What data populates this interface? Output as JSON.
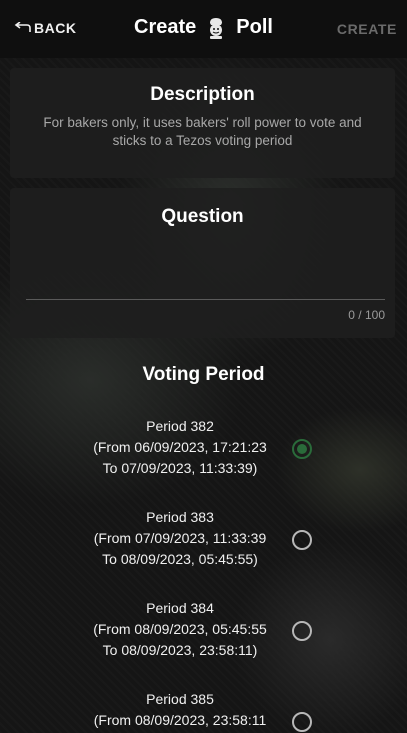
{
  "header": {
    "back_label": "BACK",
    "title_left": "Create",
    "title_right": "Poll",
    "create_label": "CREATE"
  },
  "description": {
    "heading": "Description",
    "text": "For bakers only, it uses bakers' roll power to vote and sticks to a Tezos voting period"
  },
  "question": {
    "heading": "Question",
    "value": "",
    "counter": "0 / 100"
  },
  "voting_period": {
    "heading": "Voting Period",
    "selected_index": 0,
    "periods": [
      {
        "title": "Period 382",
        "from": "(From 06/09/2023, 17:21:23",
        "to": "To 07/09/2023, 11:33:39)"
      },
      {
        "title": "Period 383",
        "from": "(From 07/09/2023, 11:33:39",
        "to": "To 08/09/2023, 05:45:55)"
      },
      {
        "title": "Period 384",
        "from": "(From 08/09/2023, 05:45:55",
        "to": "To 08/09/2023, 23:58:11)"
      },
      {
        "title": "Period 385",
        "from": "(From 08/09/2023, 23:58:11",
        "to": ""
      }
    ]
  },
  "colors": {
    "header_bg": "#0f0f0f",
    "card_bg": "#1e1e1e",
    "selected_radio": "#2a6b3a",
    "create_disabled": "#6a6a6a"
  }
}
